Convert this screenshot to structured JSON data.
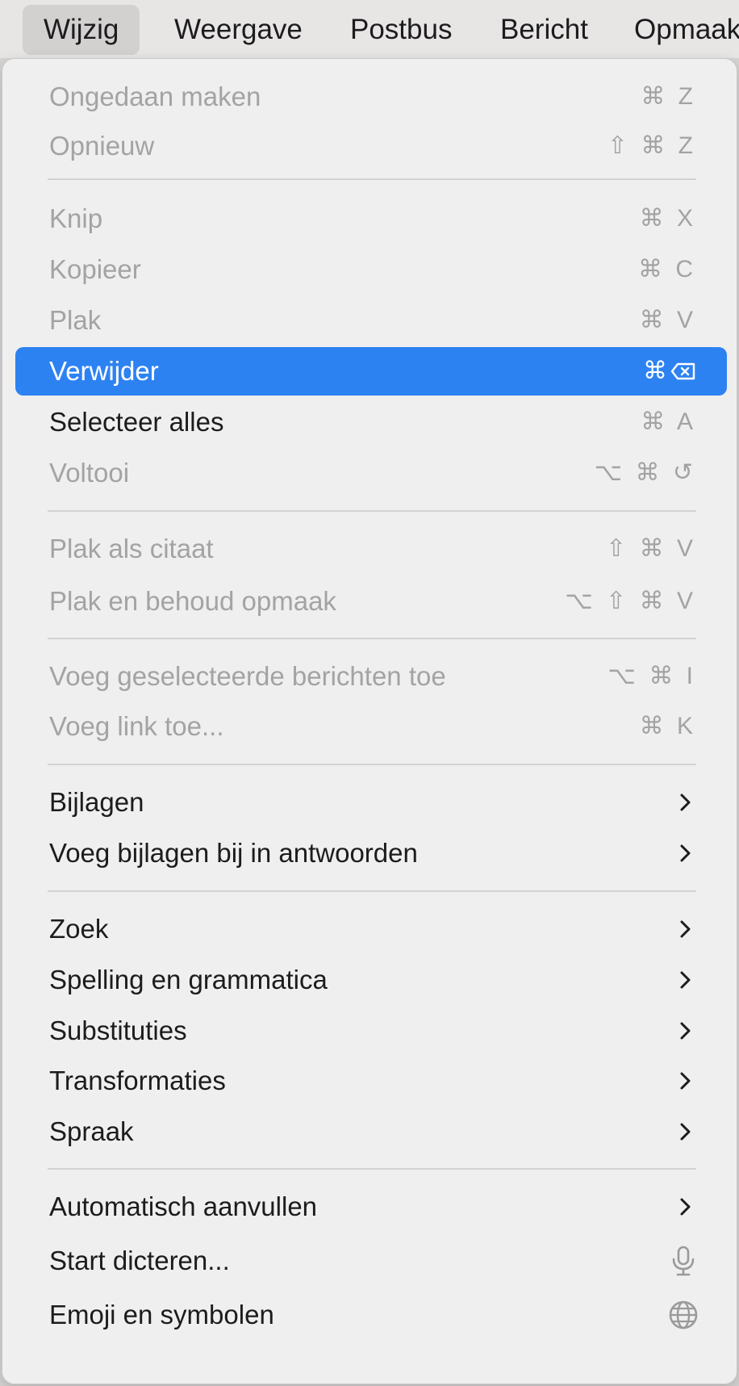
{
  "menubar": {
    "items": [
      "Wijzig",
      "Weergave",
      "Postbus",
      "Bericht",
      "Opmaak"
    ]
  },
  "menu": {
    "items": [
      {
        "label": "Ongedaan maken",
        "shortcut": "⌘ Z",
        "enabled": false
      },
      {
        "label": "Opnieuw",
        "shortcut": "⇧ ⌘ Z",
        "enabled": false
      },
      {
        "label": "Knip",
        "shortcut": "⌘ X",
        "enabled": false
      },
      {
        "label": "Kopieer",
        "shortcut": "⌘ C",
        "enabled": false
      },
      {
        "label": "Plak",
        "shortcut": "⌘ V",
        "enabled": false
      },
      {
        "label": "Verwijder",
        "shortcut": "⌘",
        "enabled": true,
        "selected": true
      },
      {
        "label": "Selecteer alles",
        "shortcut": "⌘ A",
        "enabled": true
      },
      {
        "label": "Voltooi",
        "shortcut": "⌥ ⌘ ↺",
        "enabled": false
      },
      {
        "label": "Plak als citaat",
        "shortcut": "⇧ ⌘ V",
        "enabled": false
      },
      {
        "label": "Plak en behoud opmaak",
        "shortcut": "⌥ ⇧ ⌘ V",
        "enabled": false
      },
      {
        "label": "Voeg geselecteerde berichten toe",
        "shortcut": "⌥ ⌘ I",
        "enabled": false
      },
      {
        "label": "Voeg link toe...",
        "shortcut": "⌘ K",
        "enabled": false
      },
      {
        "label": "Bijlagen",
        "submenu": true,
        "enabled": true
      },
      {
        "label": "Voeg bijlagen bij in antwoorden",
        "submenu": true,
        "enabled": true
      },
      {
        "label": "Zoek",
        "submenu": true,
        "enabled": true
      },
      {
        "label": "Spelling en grammatica",
        "submenu": true,
        "enabled": true
      },
      {
        "label": "Substituties",
        "submenu": true,
        "enabled": true
      },
      {
        "label": "Transformaties",
        "submenu": true,
        "enabled": true
      },
      {
        "label": "Spraak",
        "submenu": true,
        "enabled": true
      },
      {
        "label": "Automatisch aanvullen",
        "submenu": true,
        "enabled": true
      },
      {
        "label": "Start dicteren...",
        "icon": "microphone-icon",
        "enabled": true
      },
      {
        "label": "Emoji en symbolen",
        "icon": "globe-icon",
        "enabled": true
      }
    ]
  },
  "colors": {
    "selection": "#2d82f2",
    "disabled_text": "#a3a3a3",
    "menu_background": "#efefef"
  }
}
